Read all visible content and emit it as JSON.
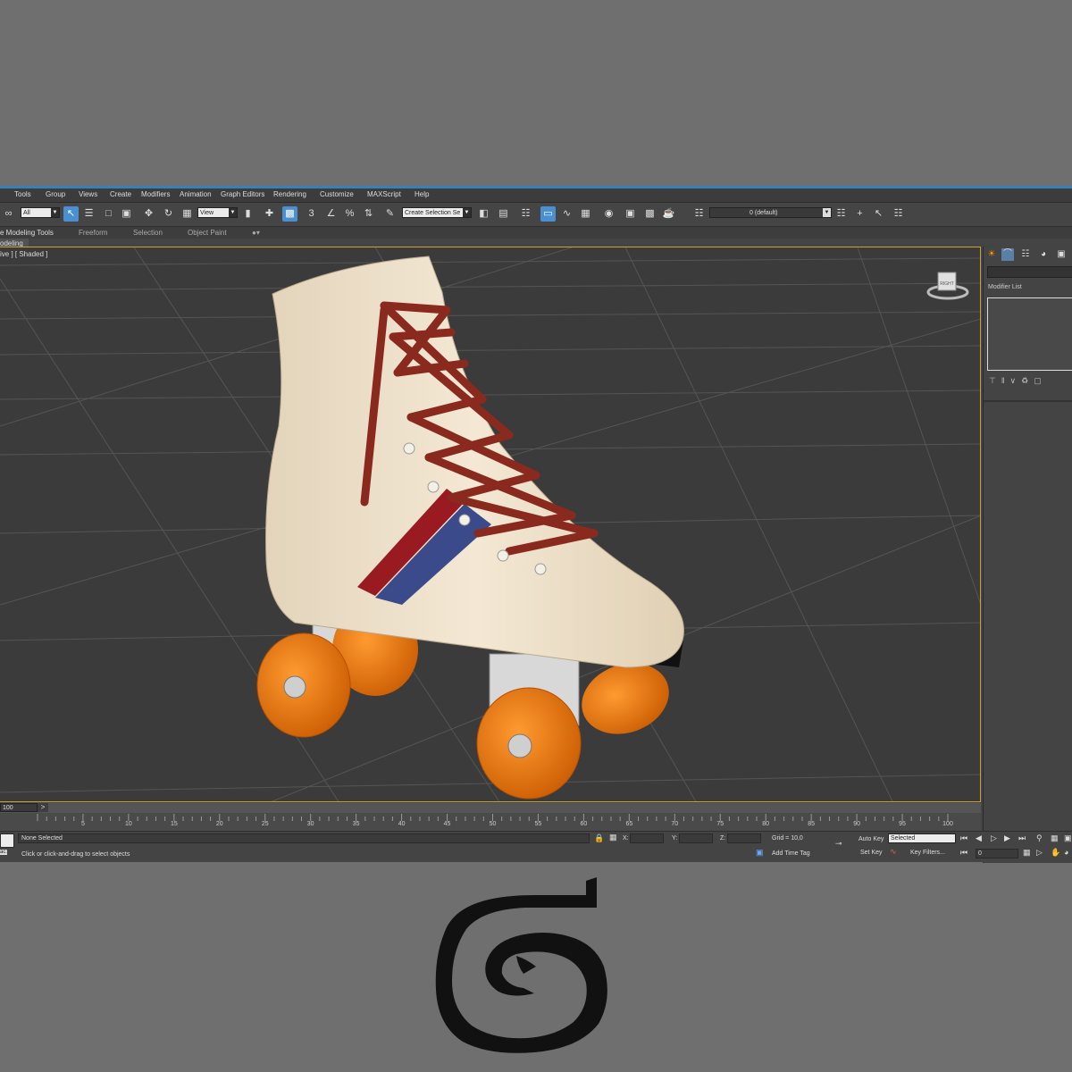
{
  "menu": [
    "Tools",
    "Group",
    "Views",
    "Create",
    "Modifiers",
    "Animation",
    "Graph Editors",
    "Rendering",
    "Customize",
    "MAXScript",
    "Help"
  ],
  "toolbar": {
    "selection_filter": "All",
    "coordinate_system": "View",
    "selection_set_placeholder": "Create Selection Se",
    "layer_value": "0 (default)"
  },
  "ribbon": {
    "tabs": [
      "e Modeling Tools",
      "Freeform",
      "Selection",
      "Object Paint"
    ],
    "subtab": "odeling"
  },
  "viewport": {
    "label": "ive ] [ Shaded ]",
    "viewcube_face": "RIGHT"
  },
  "command_panel": {
    "modifier_list_label": "Modifier List"
  },
  "timeline": {
    "slider_label": "100",
    "next_label": ">",
    "ticks": [
      "5",
      "10",
      "15",
      "20",
      "25",
      "30",
      "35",
      "40",
      "45",
      "50",
      "55",
      "60",
      "65",
      "70",
      "75",
      "80",
      "85",
      "90",
      "95",
      "100"
    ]
  },
  "status": {
    "selection_status": "None Selected",
    "prompt": "Click or click-and-drag to select objects",
    "x_label": "X:",
    "y_label": "Y:",
    "z_label": "Z:",
    "grid": "Grid = 10,0",
    "add_time_tag": "Add Time Tag",
    "auto_key": "Auto Key",
    "set_key": "Set Key",
    "key_mode": "Selected",
    "key_filters": "Key Filters...",
    "frame": "0",
    "script_fragment": "ac:"
  },
  "colors": {
    "accent": "#4a8fd0",
    "viewport_border": "#c9a23a",
    "boot": "#efe2cc",
    "laces": "#8a2a1e",
    "wheels": "#ee7a10",
    "stripe_red": "#9a1a22",
    "stripe_blue": "#3a4a8a"
  },
  "icons": [
    "select-object-icon",
    "select-by-name-icon",
    "rectangular-selection-icon",
    "window-crossing-icon",
    "move-icon",
    "rotate-icon",
    "scale-icon",
    "mirror-icon",
    "align-icon",
    "layer-manager-icon",
    "material-editor-icon",
    "render-setup-icon",
    "render-icon",
    "viewcube-icon",
    "3ds-max-logo"
  ]
}
